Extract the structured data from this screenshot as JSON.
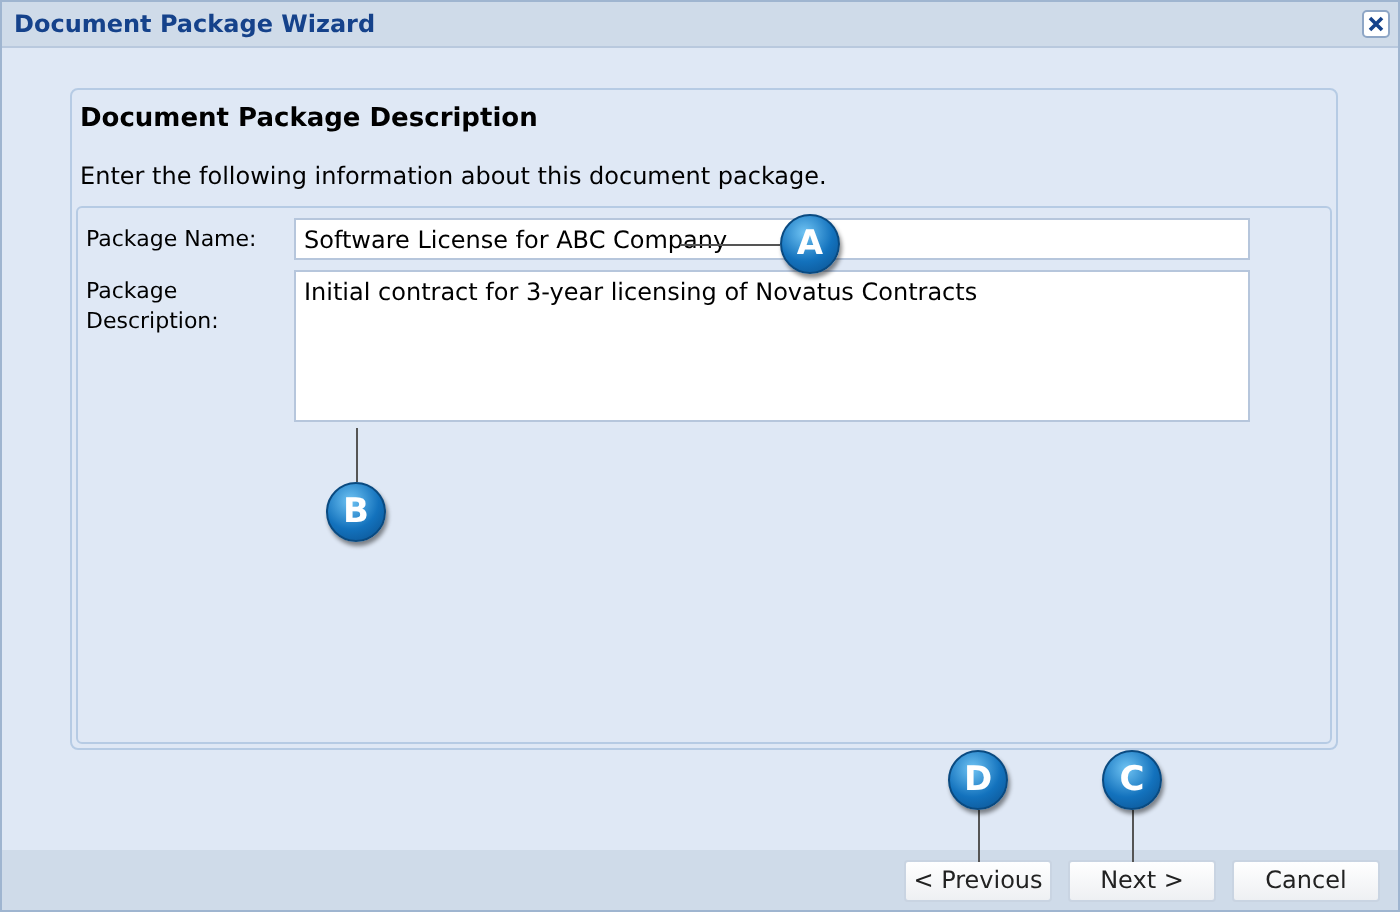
{
  "window": {
    "title": "Document Package Wizard"
  },
  "section": {
    "heading": "Document Package Description",
    "instruction": "Enter the following information about this document package."
  },
  "fields": [
    {
      "kind": "single",
      "label": "Package Name:",
      "value": "Software License for ABC Company"
    },
    {
      "kind": "multi",
      "label": "Package Description:",
      "value": "Initial contract for 3-year licensing of Novatus Contracts"
    }
  ],
  "buttons": [
    {
      "label": "< Previous"
    },
    {
      "label": "Next >"
    },
    {
      "label": "Cancel"
    }
  ],
  "callouts": [
    {
      "letter": "A"
    },
    {
      "letter": "B"
    },
    {
      "letter": "D"
    },
    {
      "letter": "C"
    }
  ]
}
